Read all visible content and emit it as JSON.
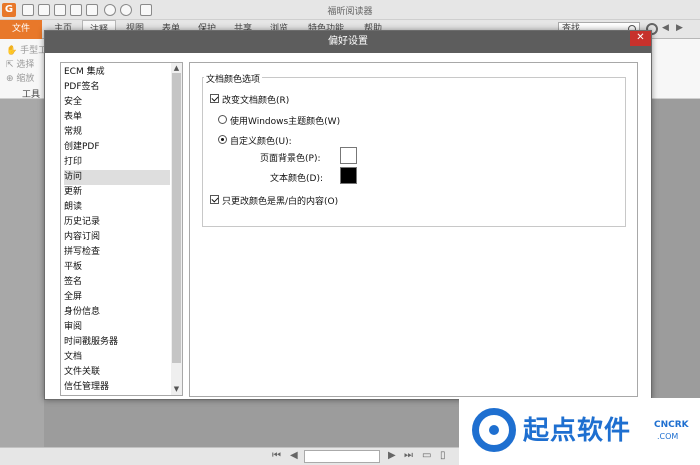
{
  "window": {
    "title": "福昕阅读器"
  },
  "ribbon": {
    "file_tab": "文件",
    "tabs": [
      "主页",
      "注释",
      "视图",
      "表单",
      "保护",
      "共享",
      "浏览",
      "特色功能",
      "帮助"
    ],
    "search_placeholder": "查找"
  },
  "toolbar": {
    "tools": [
      "手型工",
      "选择",
      "缩放"
    ],
    "group_label": "工具"
  },
  "dialog": {
    "title": "偏好设置",
    "close": "✕",
    "categories": [
      "ECM 集成",
      "PDF签名",
      "安全",
      "表单",
      "常规",
      "创建PDF",
      "打印",
      "访问",
      "更新",
      "朗读",
      "历史记录",
      "内容订阅",
      "拼写检查",
      "平板",
      "签名",
      "全屏",
      "身份信息",
      "审阅",
      "时间戳服务器",
      "文档",
      "文件关联",
      "信任管理器"
    ],
    "selected_category": "访问",
    "group_title": "文档颜色选项",
    "change_color_label": "改变文档颜色(R)",
    "use_windows_label": "使用Windows主题颜色(W)",
    "custom_label": "自定义颜色(U):",
    "page_bg_label": "页面背景色(P):",
    "text_color_label": "文本颜色(D):",
    "only_bw_label": "只更改颜色是黑/白的内容(O)",
    "page_bg_color": "#ffffff",
    "text_color": "#000000"
  },
  "watermark": {
    "brand": "起点软件",
    "site": "CNCRK",
    "domain": ".COM"
  }
}
